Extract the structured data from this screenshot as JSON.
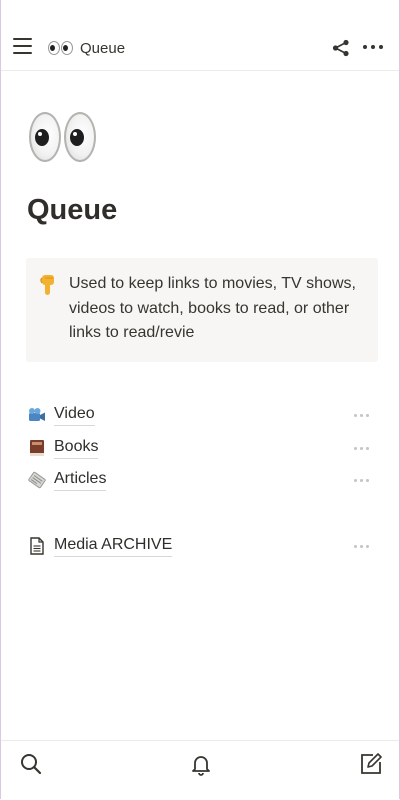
{
  "header": {
    "breadcrumb_title": "Queue",
    "icons": [
      "menu-icon",
      "eyes-icon",
      "share-icon",
      "more-horizontal-icon"
    ]
  },
  "page": {
    "icon": "eyes-icon",
    "title": "Queue",
    "callout": {
      "icon": "pointing-down-icon",
      "text": "Used to keep links to movies, TV shows, videos to watch, books to read, or other links to read/revie"
    },
    "links": [
      {
        "label": "Video",
        "icon": "movie-camera-icon"
      },
      {
        "label": "Books",
        "icon": "book-icon"
      },
      {
        "label": "Articles",
        "icon": "newspaper-icon"
      }
    ],
    "archive": {
      "label": "Media ARCHIVE",
      "icon": "document-icon"
    }
  },
  "bottom_bar": {
    "icons": [
      "search-icon",
      "bell-icon",
      "compose-icon"
    ]
  },
  "colors": {
    "text": "#37352f",
    "callout_bg": "#f7f6f5",
    "divider": "#ebebea",
    "muted_dots": "#c4c4c2"
  }
}
